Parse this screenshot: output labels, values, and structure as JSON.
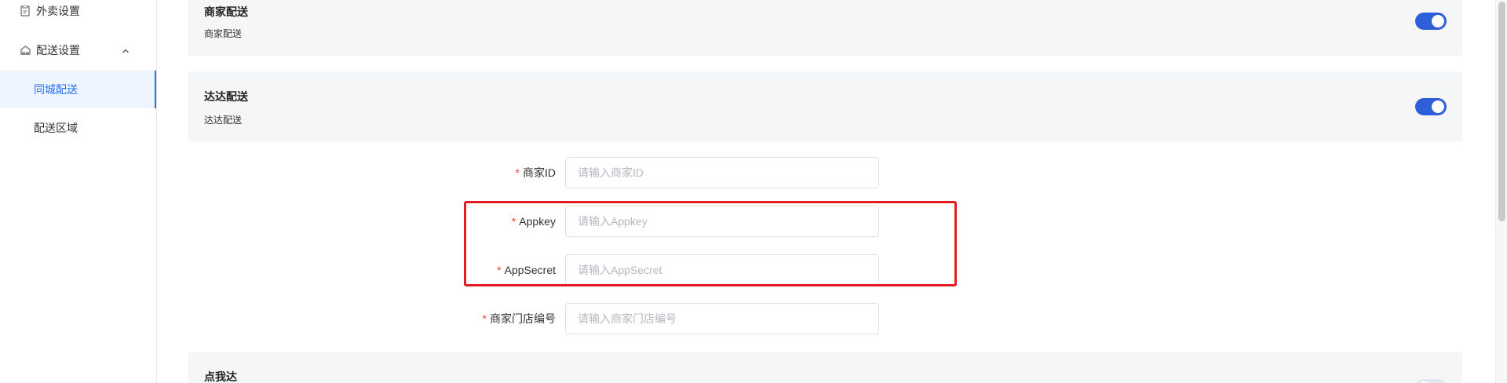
{
  "sidebar": {
    "items": [
      {
        "label": "外卖设置",
        "icon": "document-icon"
      },
      {
        "label": "配送设置",
        "icon": "delivery-icon"
      },
      {
        "label": "同城配送",
        "active": true
      },
      {
        "label": "配送区域"
      }
    ]
  },
  "cards": {
    "merchant": {
      "title": "商家配送",
      "desc": "商家配送",
      "enabled": true
    },
    "dada": {
      "title": "达达配送",
      "desc": "达达配送",
      "enabled": true
    },
    "dianwoda": {
      "title": "点我达",
      "enabled": false
    }
  },
  "form": {
    "merchant_id": {
      "label": "商家ID",
      "placeholder": "请输入商家ID",
      "value": ""
    },
    "appkey": {
      "label": "Appkey",
      "placeholder": "请输入Appkey",
      "value": ""
    },
    "appsecret": {
      "label": "AppSecret",
      "placeholder": "请输入AppSecret",
      "value": ""
    },
    "store_no": {
      "label": "商家门店编号",
      "placeholder": "请输入商家门店编号",
      "value": ""
    },
    "required_mark": "*"
  },
  "colors": {
    "accent": "#2f5fd8",
    "active_menu_bg": "#eef5ff",
    "active_menu_text": "#2a6df4",
    "highlight_box": "#e31b23",
    "card_bg": "#f5f6f8"
  }
}
